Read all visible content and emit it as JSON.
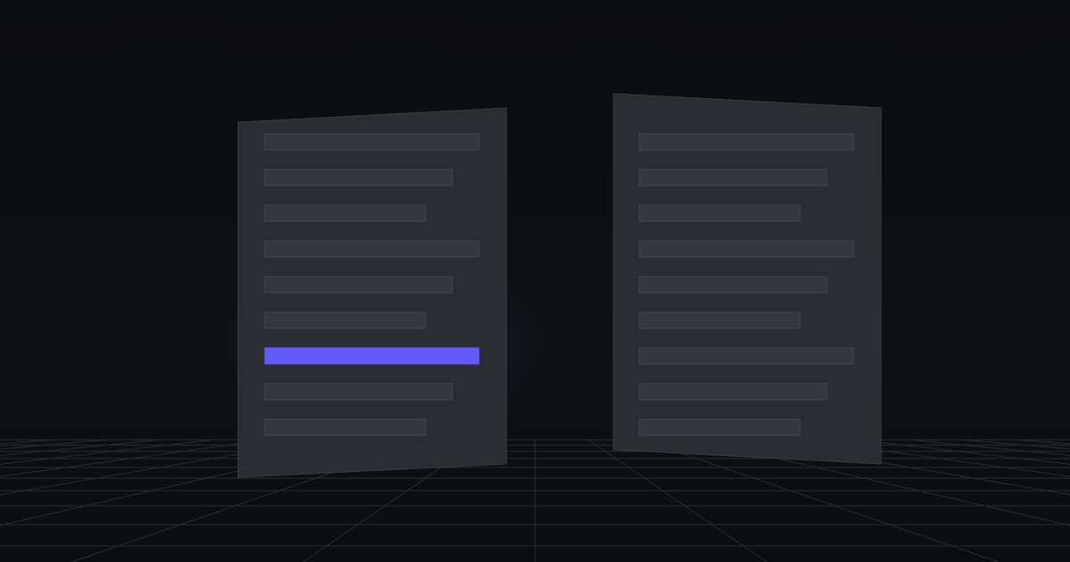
{
  "colors": {
    "background": "#0d0e10",
    "panel": "#2a2d32",
    "panel_edge": "#3a3d43",
    "bar": "#34373d",
    "bar_edge": "#45484e",
    "highlight": "#635bff",
    "grid": "#2a2c30"
  },
  "left_panel": {
    "highlighted_row": 6,
    "row_count": 9
  },
  "right_panel": {
    "highlighted_row": -1,
    "row_count": 9
  }
}
